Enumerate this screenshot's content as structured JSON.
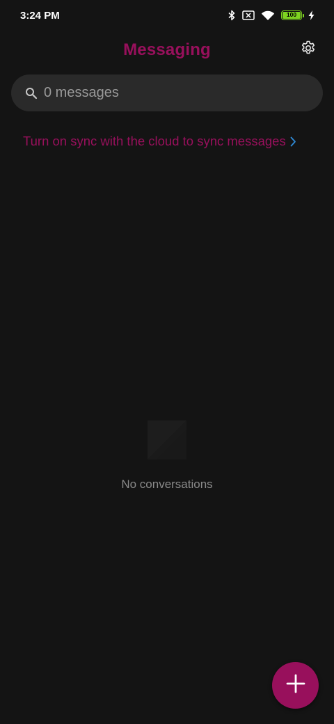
{
  "status_bar": {
    "time": "3:24 PM",
    "battery_level": "100",
    "icons": [
      "bluetooth-icon",
      "no-sim-icon",
      "wifi-icon",
      "battery-icon",
      "charging-icon"
    ]
  },
  "header": {
    "title": "Messaging",
    "settings_icon": "gear-icon"
  },
  "search": {
    "placeholder": "0 messages",
    "value": "",
    "icon": "search-icon"
  },
  "sync": {
    "label": "Turn on sync with the cloud to sync messages",
    "icon": "chevron-right-icon"
  },
  "empty_state": {
    "message": "No conversations",
    "icon": "empty-conversation-icon"
  },
  "fab": {
    "icon": "plus-icon"
  },
  "colors": {
    "accent": "#98105c",
    "background": "#141414",
    "search_background": "#2a2a2a",
    "battery": "#7ed321",
    "link_chevron": "#2f8bd8"
  }
}
